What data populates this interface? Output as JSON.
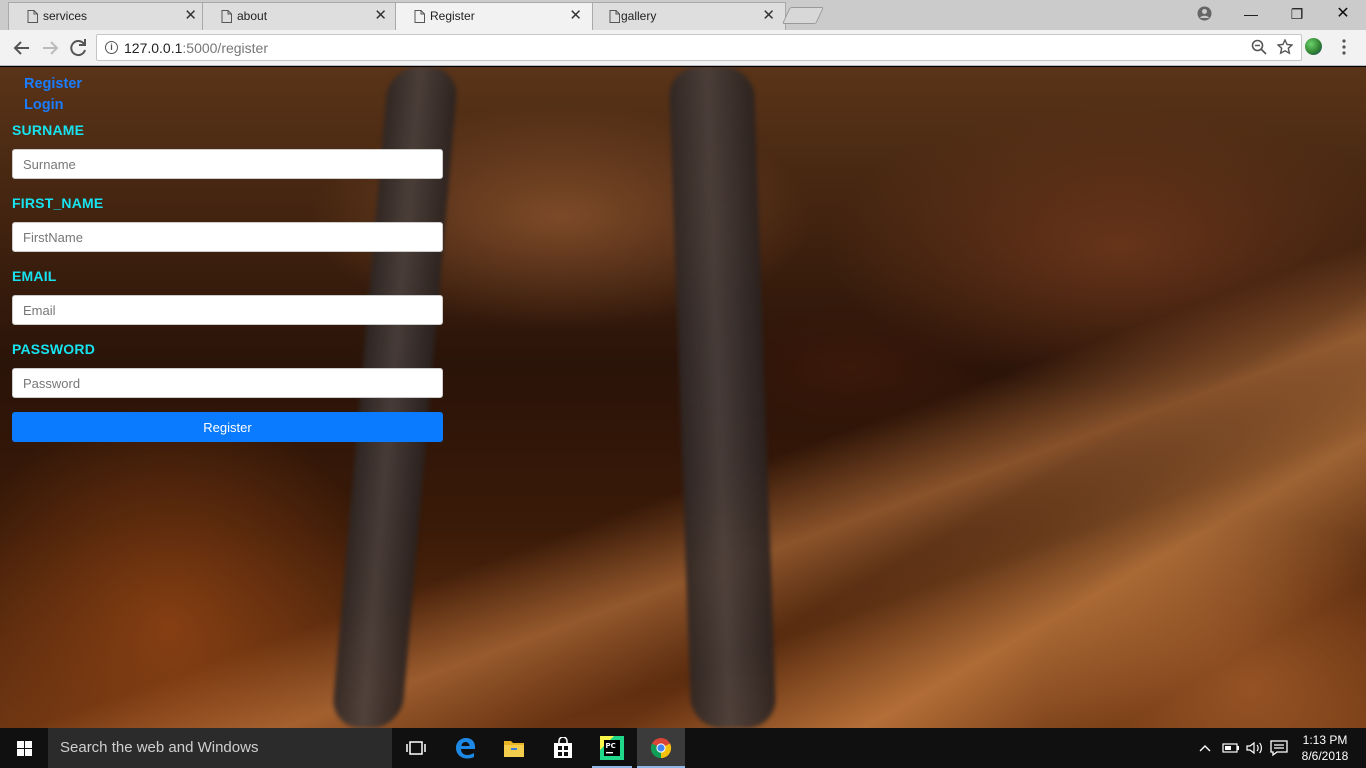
{
  "browser": {
    "tabs": [
      {
        "title": "services",
        "close": "✕"
      },
      {
        "title": "about",
        "close": "✕"
      },
      {
        "title": "Register",
        "close": "✕"
      },
      {
        "title": "gallery",
        "close": "✕"
      }
    ],
    "url_host": "127.0.0.1",
    "url_path": ":5000/register",
    "window_controls": {
      "minimize": "—",
      "restore": "❐",
      "close": "✕"
    }
  },
  "page": {
    "nav": {
      "register": "Register",
      "login": "Login"
    },
    "form": {
      "surname": {
        "label": "SURNAME",
        "placeholder": "Surname"
      },
      "first_name": {
        "label": "FIRST_NAME",
        "placeholder": "FirstName"
      },
      "email": {
        "label": "EMAIL",
        "placeholder": "Email"
      },
      "password": {
        "label": "PASSWORD",
        "placeholder": "Password"
      },
      "submit": "Register"
    },
    "colors": {
      "label": "#17e3f0",
      "link": "#1a7cff",
      "button": "#0a7bff"
    }
  },
  "taskbar": {
    "search_placeholder": "Search the web and Windows",
    "time": "1:13 PM",
    "date": "8/6/2018",
    "pinned_icons": [
      "task-view-icon",
      "edge-icon",
      "file-explorer-icon",
      "store-icon",
      "pycharm-icon",
      "chrome-icon"
    ]
  }
}
